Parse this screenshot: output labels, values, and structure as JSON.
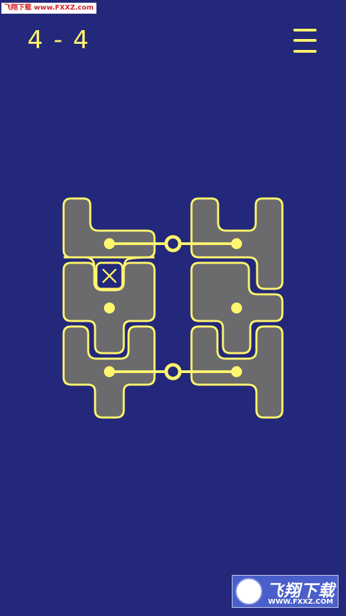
{
  "watermark_top": "飞翔下载 www.FXXZ.com",
  "level": "4 - 4",
  "menu_icon": "hamburger-menu-icon",
  "watermark_bottom": {
    "name": "飞翔下载",
    "url": "WWW.FXXZ.COM"
  },
  "colors": {
    "background": "#23287a",
    "accent": "#fff56e",
    "piece_fill": "#6b6b6d"
  }
}
